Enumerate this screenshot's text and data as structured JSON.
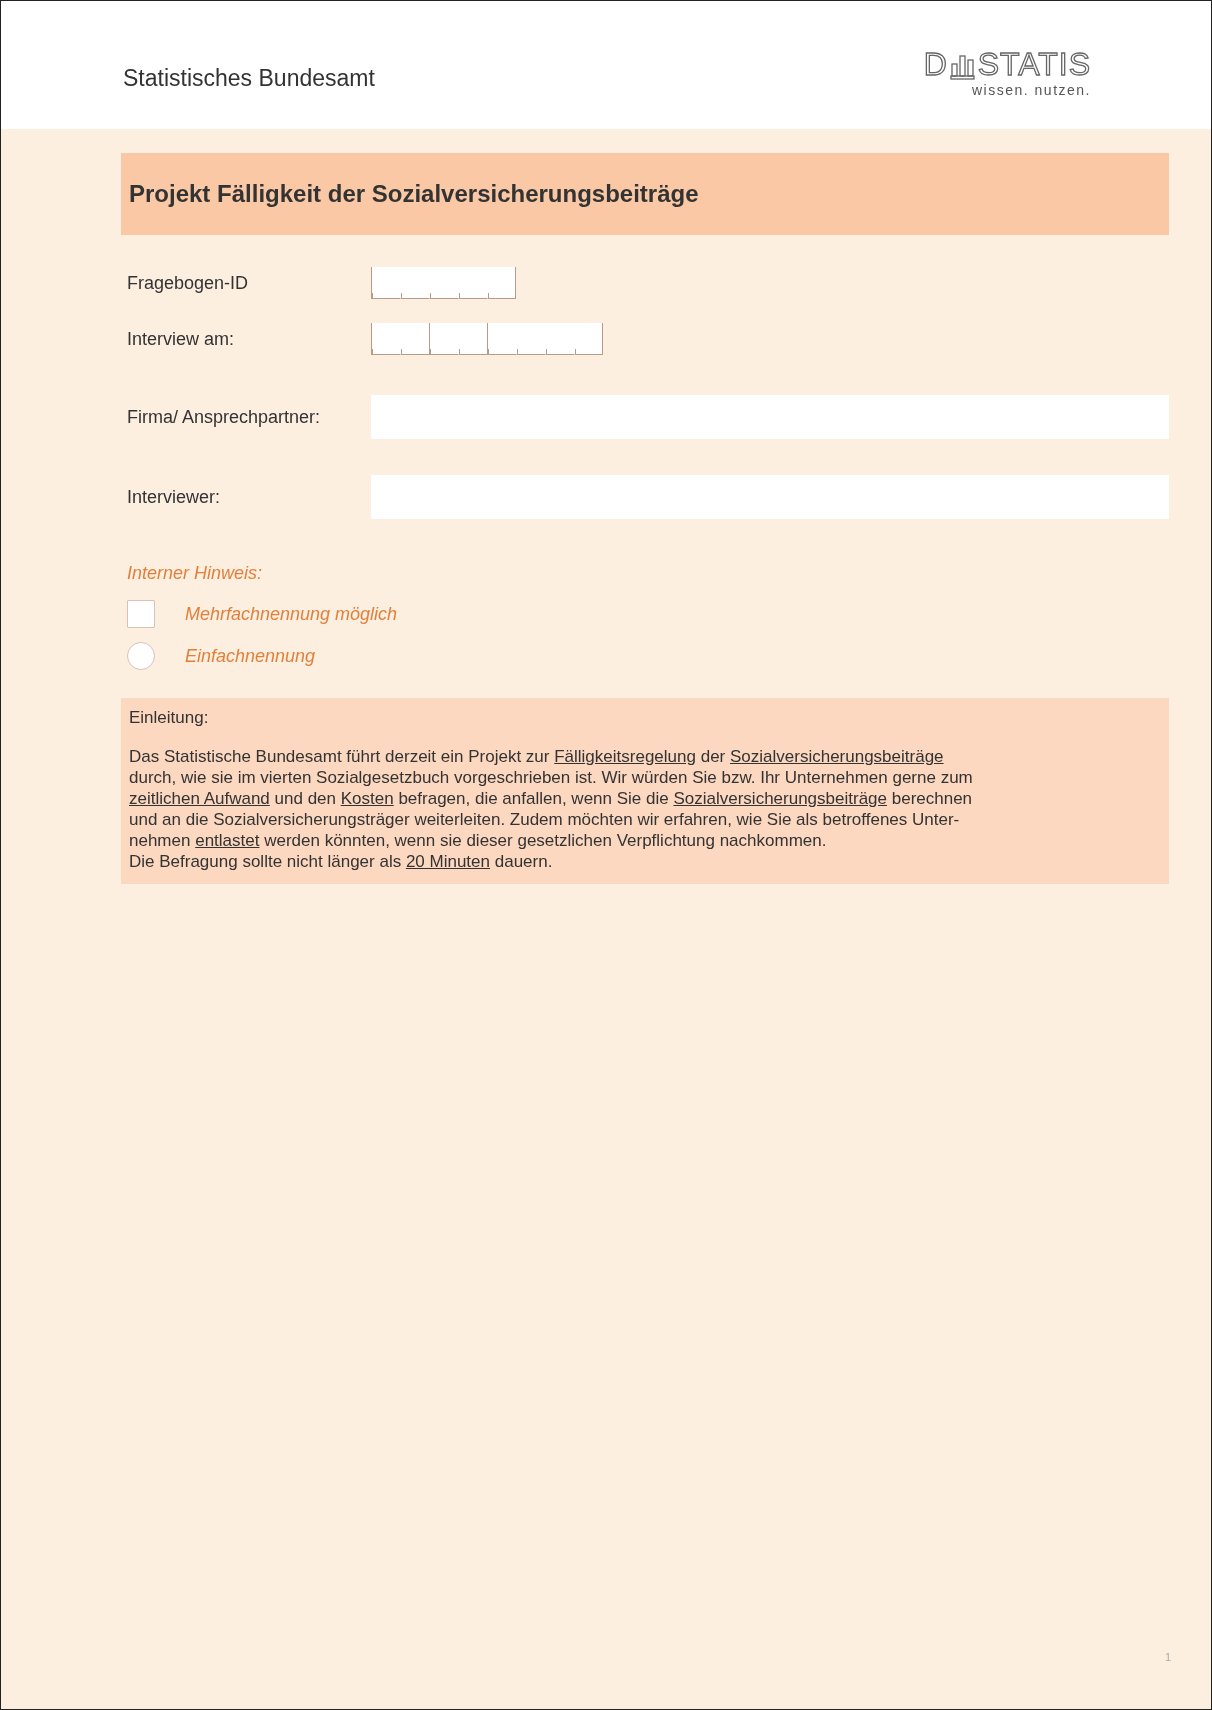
{
  "header": {
    "org_name": "Statistisches Bundesamt",
    "logo": {
      "left": "D",
      "right": "STATIS",
      "tagline": "wissen. nutzen."
    }
  },
  "title": "Projekt Fälligkeit der Sozialversicherungsbeiträge",
  "fields": [
    {
      "label": "Fragebogen-ID",
      "kind": "id"
    },
    {
      "label": "Interview am:",
      "kind": "date"
    },
    {
      "label": "Firma/ Ansprechpartner:",
      "kind": "text"
    },
    {
      "label": "Interviewer:",
      "kind": "text"
    }
  ],
  "legend": {
    "heading": "Interner Hinweis:",
    "items": [
      {
        "kind": "checkbox",
        "label": "Mehrfachnennung möglich",
        "checked": false
      },
      {
        "kind": "radio",
        "label": "Einfachnennung",
        "checked": false
      }
    ]
  },
  "intro": {
    "heading": "Einleitung:",
    "lines": [
      [
        {
          "text": "Das Statistische Bundesamt führt derzeit ein Projekt zur ",
          "underlined": false
        },
        {
          "text": "Fälligkeitsregelung",
          "underlined": true
        },
        {
          "text": " der ",
          "underlined": false
        },
        {
          "text": "Sozialversicherungsbeiträge",
          "underlined": true
        }
      ],
      [
        {
          "text": "durch, wie sie im vierten Sozialgesetzbuch vorgeschrieben ist. Wir würden Sie bzw. Ihr Unternehmen gerne zum",
          "underlined": false
        }
      ],
      [
        {
          "text": "zeitlichen Aufwand",
          "underlined": true
        },
        {
          "text": " und den ",
          "underlined": false
        },
        {
          "text": "Kosten",
          "underlined": true
        },
        {
          "text": " befragen, die anfallen, wenn Sie die ",
          "underlined": false
        },
        {
          "text": "Sozialversicherungsbeiträge",
          "underlined": true
        },
        {
          "text": " berechnen",
          "underlined": false
        }
      ],
      [
        {
          "text": "und an die Sozialversicherungsträger weiterleiten. Zudem möchten wir erfahren, wie Sie als betroffenes Unter-",
          "underlined": false
        }
      ],
      [
        {
          "text": "nehmen ",
          "underlined": false
        },
        {
          "text": "entlastet",
          "underlined": true
        },
        {
          "text": " werden könnten, wenn sie dieser gesetzlichen Verpflichtung nachkommen.",
          "underlined": false
        }
      ],
      [
        {
          "text": "Die Befragung sollte nicht länger als ",
          "underlined": false
        },
        {
          "text": "20 Minuten",
          "underlined": true
        },
        {
          "text": " dauern.",
          "underlined": false
        }
      ]
    ]
  },
  "page_number": "1"
}
